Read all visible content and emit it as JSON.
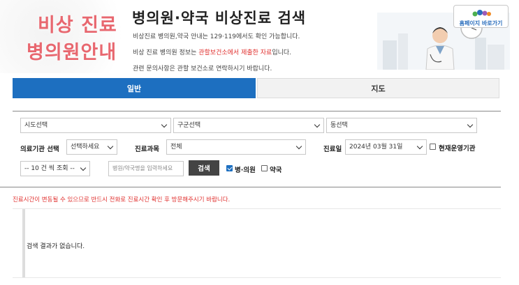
{
  "header": {
    "logo_line1": "비상 진료",
    "logo_line2": "병의원안내",
    "title": "병의원·약국 비상진료 검색",
    "desc1": "비상진료 병의원,약국 안내는 129·119에서도 확인 가능합니다.",
    "desc2_prefix": "비상 진료 병의원 정보는 ",
    "desc2_red": "관할보건소에서 제출한 자료",
    "desc2_suffix": "입니다.",
    "desc3": "관련 문의사항은 관할 보건소로 연락하시기 바랍니다.",
    "home_button": "홈페이지 바로가기",
    "home_logo_icon": "ministry-logo-icon"
  },
  "tabs": [
    {
      "label": "일반",
      "active": true
    },
    {
      "label": "지도",
      "active": false
    }
  ],
  "filters": {
    "sido": "시도선택",
    "gugun": "구군선택",
    "dong": "동선택",
    "institution_label": "의료기관 선택",
    "institution_value": "선택하세요",
    "department_label": "진료과목",
    "department_value": "전체",
    "date_label": "진료일",
    "date_value": "2024년 03월 31일",
    "open_now_label": "현재운영기관",
    "page_size": "-- 10 건 씩 조회 --",
    "search_placeholder": "병원/약국명을 입력하세요",
    "search_button": "검색",
    "type_hospital": "병·의원",
    "type_pharmacy": "약국"
  },
  "checks": {
    "open_now": false,
    "hospital": true,
    "pharmacy": false
  },
  "notice": "진료시간이 변동될 수 있으므로 반드시 전화로 진료시간 확인 후 방문해주시기 바랍니다.",
  "result": {
    "empty_message": "검색 결과가 없습니다."
  },
  "colors": {
    "accent": "#1d6fc0",
    "logo": "#e8676f",
    "warning": "#e0312f"
  }
}
